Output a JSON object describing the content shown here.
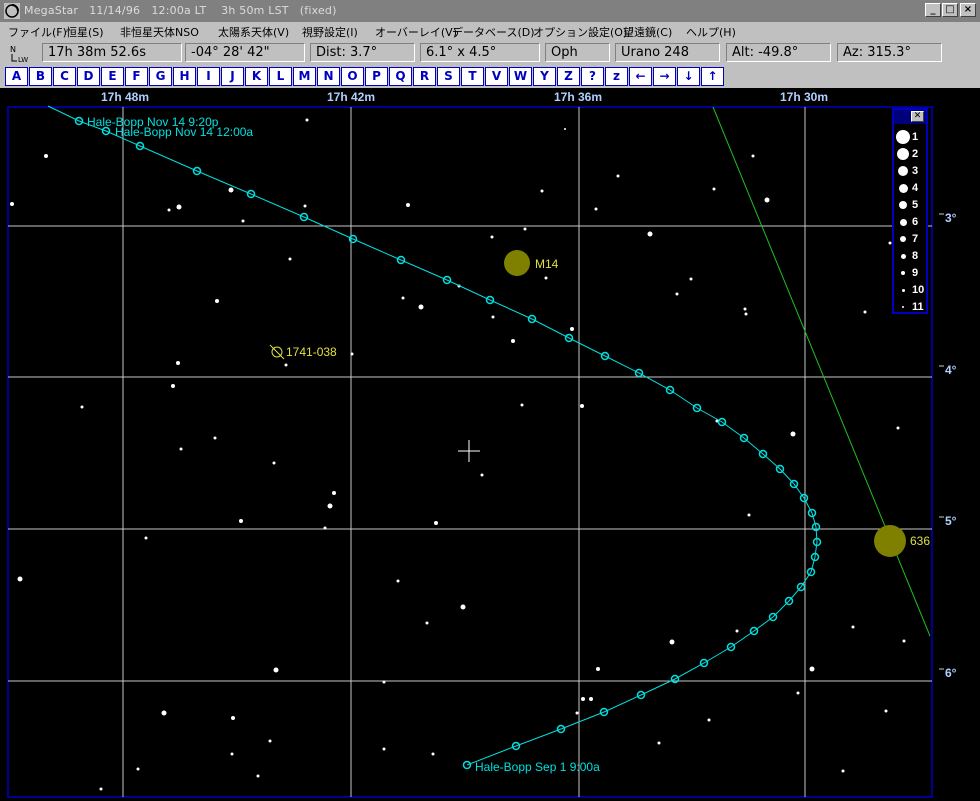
{
  "window": {
    "title": "MegaStar   11/14/96   12:00a LT    3h 50m LST   (fixed)",
    "buttons": [
      "_",
      "□",
      "×"
    ]
  },
  "menu": [
    "ファイル(F)",
    "恒星(S)",
    "非恒星天体NSO",
    "太陽系天体(V)",
    "視野設定(I)",
    "オーバーレイ(V)",
    "データベース(D)",
    "オプション設定(O)",
    "望遠鏡(C)",
    "ヘルプ(H)"
  ],
  "orientation_label": "N\nLW",
  "status": {
    "ra": "17h 38m 52.6s",
    "dec": "-04° 28' 42\"",
    "dist": "Dist: 3.7°",
    "fov": "6.1° x 4.5°",
    "constellation": "Oph",
    "atlas": "Urano 248",
    "alt": "Alt: -49.8°",
    "az": "Az: 315.3°"
  },
  "letter_buttons": [
    "A",
    "B",
    "C",
    "D",
    "E",
    "F",
    "G",
    "H",
    "I",
    "J",
    "K",
    "L",
    "M",
    "N",
    "O",
    "P",
    "Q",
    "R",
    "S",
    "T",
    "V",
    "W",
    "Y",
    "Z",
    "?",
    "z",
    "←",
    "→",
    "↓",
    "↑"
  ],
  "ra_labels": [
    "17h 48m",
    "17h 42m",
    "17h 36m",
    "17h 30m"
  ],
  "dec_labels": [
    "3°",
    "4°",
    "5°",
    "6°"
  ],
  "comet_labels": {
    "nov14_920": "Hale-Bopp Nov 14 9:20p",
    "nov14_1200": "Hale-Bopp Nov 14 12:00a",
    "sep1": "Hale-Bopp Sep 1 9:00a"
  },
  "objects": {
    "m14": "M14",
    "ngc": "1741-038",
    "gc2": "636"
  },
  "legend": {
    "magnitudes": [
      "1",
      "2",
      "3",
      "4",
      "5",
      "6",
      "7",
      "8",
      "9",
      "10",
      "11"
    ]
  },
  "colors": {
    "comet_path": "#00e0e0",
    "grid": "#d0d0d0",
    "cluster": "#808000",
    "label_yellow": "#e0e040",
    "button_blue": "#0000c0",
    "ecliptic": "#20c020"
  }
}
